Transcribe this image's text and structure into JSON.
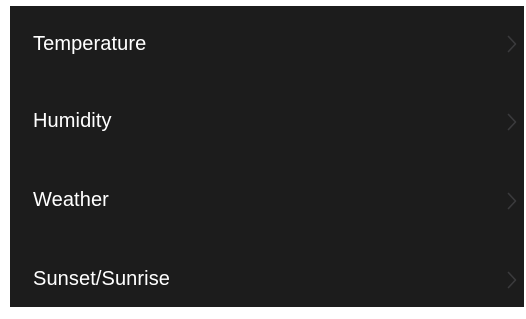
{
  "menu": {
    "items": [
      {
        "label": "Temperature",
        "icon": "chevron-right-icon"
      },
      {
        "label": "Humidity",
        "icon": "chevron-right-icon"
      },
      {
        "label": "Weather",
        "icon": "chevron-right-icon"
      },
      {
        "label": "Sunset/Sunrise",
        "icon": "chevron-right-icon"
      }
    ]
  },
  "colors": {
    "background": "#1c1c1c",
    "text": "#ffffff",
    "chevron": "#3a3a3c"
  }
}
